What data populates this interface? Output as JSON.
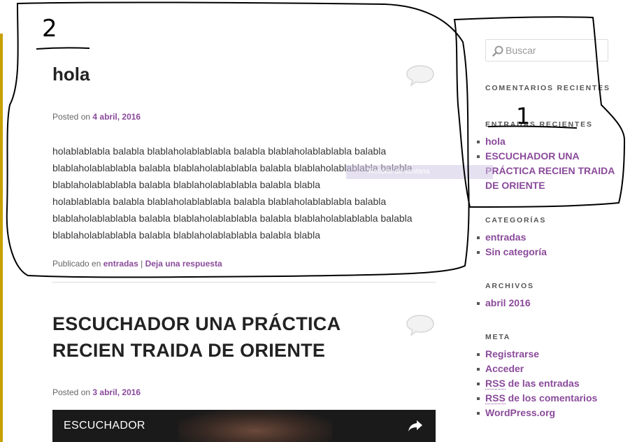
{
  "posts": [
    {
      "title": "hola",
      "posted_on_label": "Posted on",
      "date": "4 abril, 2016",
      "paragraphs": [
        "holablablabla balabla blablaholablablabla balabla blablaholablablabla balabla blablaholablablabla balabla blablaholablablabla balabla blablaholablablabla balabla blablaholablablabla balabla blablaholablablabla balabla blabla",
        "holablablabla balabla blablaholablablabla balabla blablaholablablabla balabla blablaholablablabla balabla blablaholablablabla balabla blablaholablablabla balabla blablaholablablabla balabla blablaholablablabla balabla blabla"
      ],
      "published_in_label": "Publicado en",
      "category": "entradas",
      "separator": "|",
      "reply_link": "Deja una respuesta"
    },
    {
      "title_line1": "ESCUCHADOR UNA PRÁCTICA",
      "title_line2": "RECIEN TRAIDA DE ORIENTE",
      "posted_on_label": "Posted on",
      "date": "3 abril, 2016",
      "video_title": "ESCUCHADOR"
    }
  ],
  "sidebar": {
    "search_placeholder": "Buscar",
    "recent_comments_title": "COMENTARIOS RECIENTES",
    "recent_entries_title": "ENTRADAS RECIENTES",
    "recent_entries": [
      "hola",
      "ESCUCHADOR UNA PRÁCTICA RECIEN TRAIDA DE ORIENTE"
    ],
    "categories_title": "CATEGORÍAS",
    "categories": [
      "entradas",
      "Sin categoría"
    ],
    "archives_title": "ARCHIVOS",
    "archives": [
      "abril 2016"
    ],
    "meta_title": "META",
    "meta_links": {
      "register": "Registrarse",
      "login": "Acceder",
      "rss_abbr": "RSS",
      "rss_entries_rest": " de las entradas",
      "rss_comments_rest": " de los comentarios",
      "wordpress": "WordPress.org"
    }
  },
  "tooltip": "Recorte de ventana",
  "annotations": {
    "number_left": "2",
    "number_right": "1"
  },
  "colors": {
    "link": "#8a4a9a",
    "left_bar": "#c8a000",
    "annotation_ink": "#000000"
  },
  "icons": [
    "search-icon",
    "comment-bubble-icon",
    "share-icon"
  ]
}
